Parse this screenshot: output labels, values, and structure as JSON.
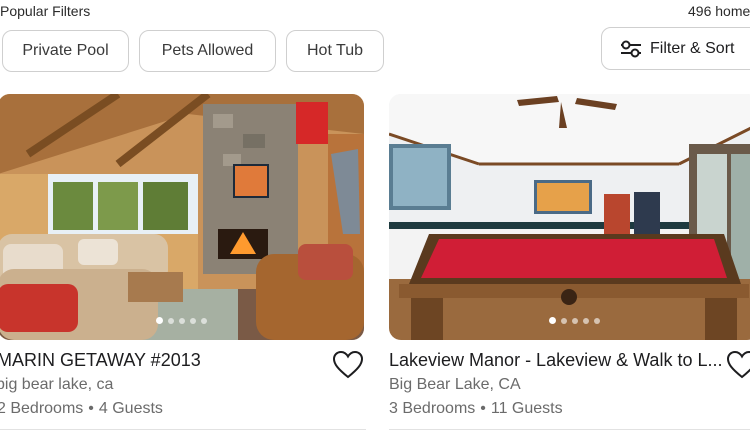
{
  "header": {
    "popular_filters_label": "Popular Filters",
    "results_count": "496 homes"
  },
  "filters": {
    "chips": [
      "Private Pool",
      "Pets Allowed",
      "Hot Tub"
    ],
    "filter_sort_label": "Filter & Sort"
  },
  "listings": [
    {
      "title": "MARIN GETAWAY #2013",
      "location": "big bear lake, ca",
      "bedrooms": "2 Bedrooms",
      "guests": "4 Guests",
      "photo": "living-room-photo",
      "carousel_position": 1,
      "carousel_count": 5
    },
    {
      "title": "Lakeview Manor - Lakeview & Walk to L...",
      "location": "Big Bear Lake, CA",
      "bedrooms": "3 Bedrooms",
      "guests": "11 Guests",
      "photo": "game-room-photo",
      "carousel_position": 1,
      "carousel_count": 5
    }
  ],
  "colors": {
    "pool_table_felt": "#d01e36",
    "wood": "#8a5a30"
  },
  "icons": {
    "favorite": "heart-outline-icon",
    "filter": "sliders-icon"
  }
}
